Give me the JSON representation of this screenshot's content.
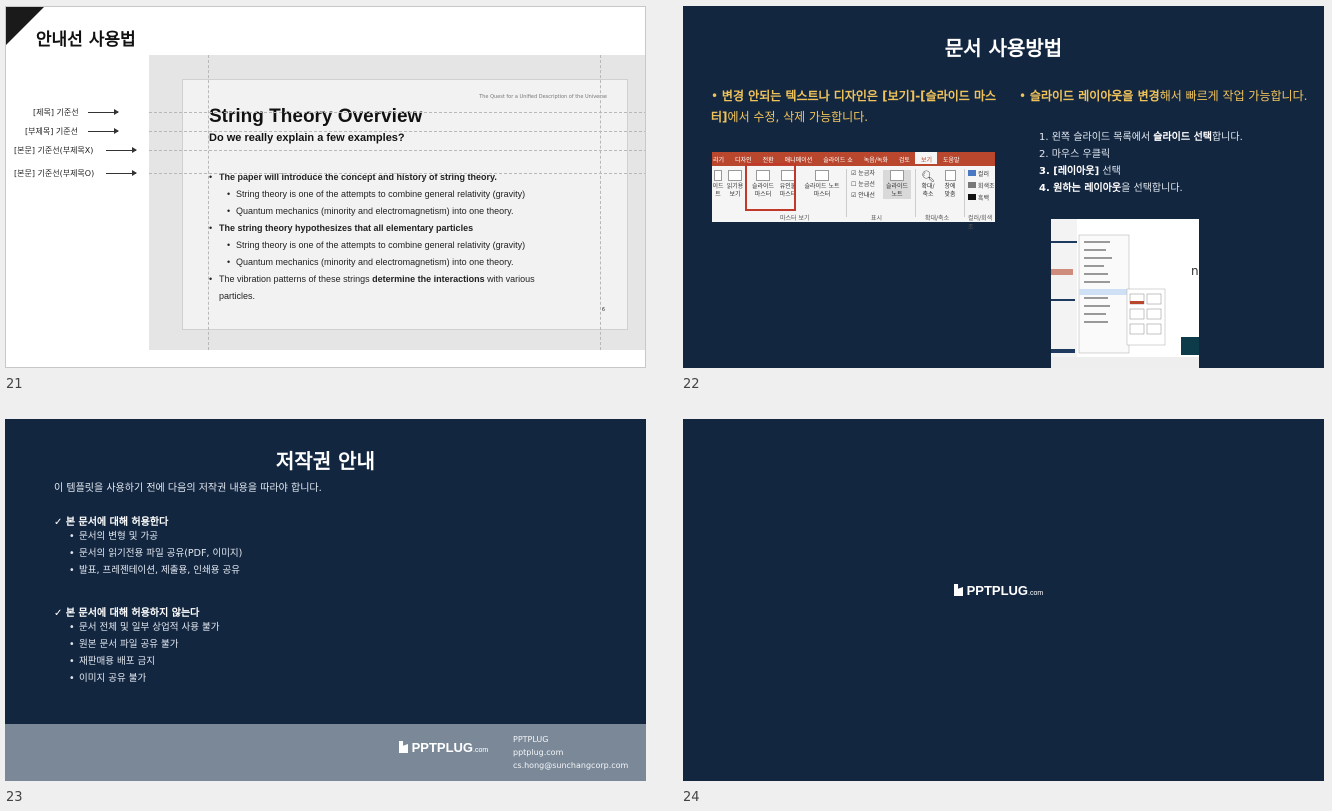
{
  "slide21": {
    "number": "21",
    "title": "안내선 사용법",
    "guides": [
      "[제목] 기준선",
      "[부제목] 기준선",
      "[본문] 기준선(부제목X)",
      "[본문] 기준선(부제목O)"
    ],
    "inner_slide": {
      "top_label": "The Quest for a Unified Description of the Universe",
      "title": "String Theory Overview",
      "subtitle": "Do we really explain a few examples?",
      "bullets": [
        {
          "text": "The paper will introduce the concept and history of string theory."
        },
        {
          "text": "String theory is one of the attempts to combine general relativity (gravity)"
        },
        {
          "text": "Quantum mechanics (minority and electromagnetism) into one theory."
        },
        {
          "text": "The string theory hypothesizes that all elementary particles"
        },
        {
          "text": "String theory is one of the attempts to combine general relativity (gravity)"
        },
        {
          "text": "Quantum mechanics (minority and electromagnetism) into one theory."
        },
        {
          "text_before": "The vibration patterns of these strings ",
          "text_bold": "determine the interactions",
          "text_after": " with various"
        },
        {
          "text": "particles."
        }
      ],
      "page_number": "6"
    }
  },
  "slide22": {
    "number": "22",
    "title": "문서 사용방법",
    "left_bullet": {
      "part1": "변경 안되는 텍스트나 디자인은 ",
      "part2": "[보기]-[슬라이드 마스터]",
      "part3": "에서 수정, 삭제 가능합니다."
    },
    "right_bullet": {
      "part1": "슬라이드 레이아웃을 변경",
      "part2": "해서 빠르게 작업 가능합니다."
    },
    "steps": [
      {
        "num": "1.",
        "before": "왼쪽 슬라이드 목록에서 ",
        "bold": "슬라이드 선택",
        "after": "합니다."
      },
      {
        "num": "2.",
        "before": "마우스 우클릭",
        "bold": "",
        "after": ""
      },
      {
        "num": "3.",
        "before": "",
        "bold": "[레이아웃]",
        "after": " 선택"
      },
      {
        "num": "4.",
        "before": "",
        "bold": "원하는 레이아웃",
        "after": "을 선택합니다."
      }
    ],
    "ribbon": {
      "tabs": [
        "리기",
        "디자인",
        "전환",
        "애니메이션",
        "슬라이드 쇼",
        "녹음/녹화",
        "검토",
        "보기",
        "도움말"
      ],
      "active_tab": "보기",
      "items": [
        "이드\n트",
        "읽기용\n보기",
        "슬라이드\n마스터",
        "유인물\n마스터",
        "슬라이드 노트\n마스터",
        "눈금자",
        "눈금선",
        "안내선",
        "슬라이드\n노트",
        "확대/\n축소",
        "창에\n맞춤",
        "컬러",
        "회색조",
        "흑백"
      ],
      "groups": [
        "마스터 보기",
        "표시",
        "확대/축소",
        "컬러/회색조"
      ]
    }
  },
  "slide23": {
    "number": "23",
    "title": "저작권 안내",
    "intro": "이 템플릿을 사용하기 전에 다음의 저작권 내용을 따라야 합니다.",
    "allowed_heading": "✓  본 문서에 대해 허용한다",
    "allowed": [
      "문서의 변형 및 가공",
      "문서의 읽기전용 파일 공유(PDF, 이미지)",
      "발표, 프레젠테이션, 제출용, 인쇄용 공유"
    ],
    "denied_heading": "✓  본 문서에 대해 허용하지 않는다",
    "denied": [
      "문서 전체 및 일부 상업적 사용 불가",
      "원본 문서 파일 공유 불가",
      "재판매용 배포 금지",
      "이미지 공유 불가"
    ],
    "brand": "PPTPLUG",
    "brand_suffix": ".com",
    "contact": [
      "PPTPLUG",
      "pptplug.com",
      "cs.hong@sunchangcorp.com"
    ]
  },
  "slide24": {
    "number": "24",
    "brand": "PPTPLUG",
    "brand_suffix": ".com"
  },
  "colors": {
    "navy": "#132640",
    "accent_yellow": "#f0c35a",
    "footer_gray": "#7a8898",
    "ribbon_red": "#b8472d"
  }
}
